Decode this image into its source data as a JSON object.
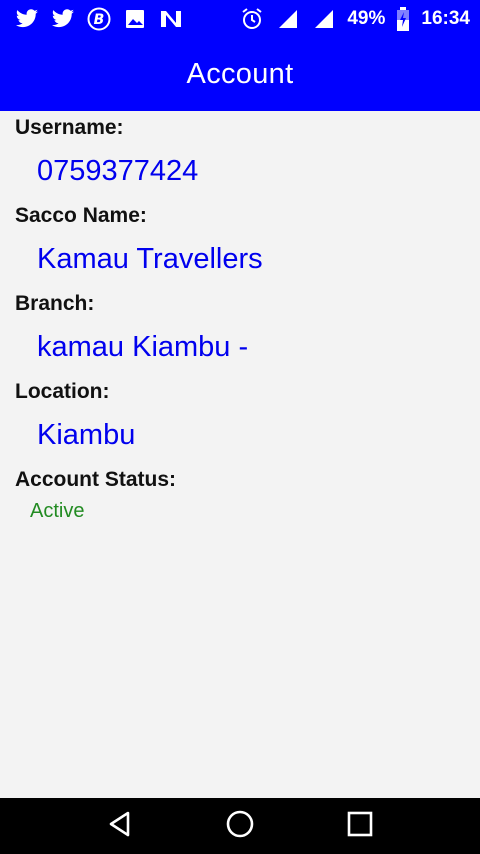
{
  "status_bar": {
    "battery": "49%",
    "time": "16:34",
    "left_icons": [
      "twitter-icon",
      "twitter-icon",
      "bitcoin-icon",
      "image-icon",
      "n-app-icon"
    ],
    "right_icons": [
      "alarm-icon",
      "signal-icon",
      "signal-icon",
      "battery-charging-icon"
    ]
  },
  "app_bar": {
    "title": "Account"
  },
  "account": {
    "username_label": "Username:",
    "username": "0759377424",
    "sacco_label": "Sacco Name:",
    "sacco": "Kamau Travellers",
    "branch_label": "Branch:",
    "branch": "kamau Kiambu -",
    "location_label": "Location:",
    "location": "Kiambu",
    "status_label": "Account Status:",
    "status": "Active"
  },
  "nav_bar": {
    "icons": [
      "back-icon",
      "home-icon",
      "recents-icon"
    ]
  },
  "colors": {
    "primary": "#0000ff",
    "value_text": "#0000ee",
    "status_active": "#228b22",
    "background": "#f3f3f3"
  }
}
